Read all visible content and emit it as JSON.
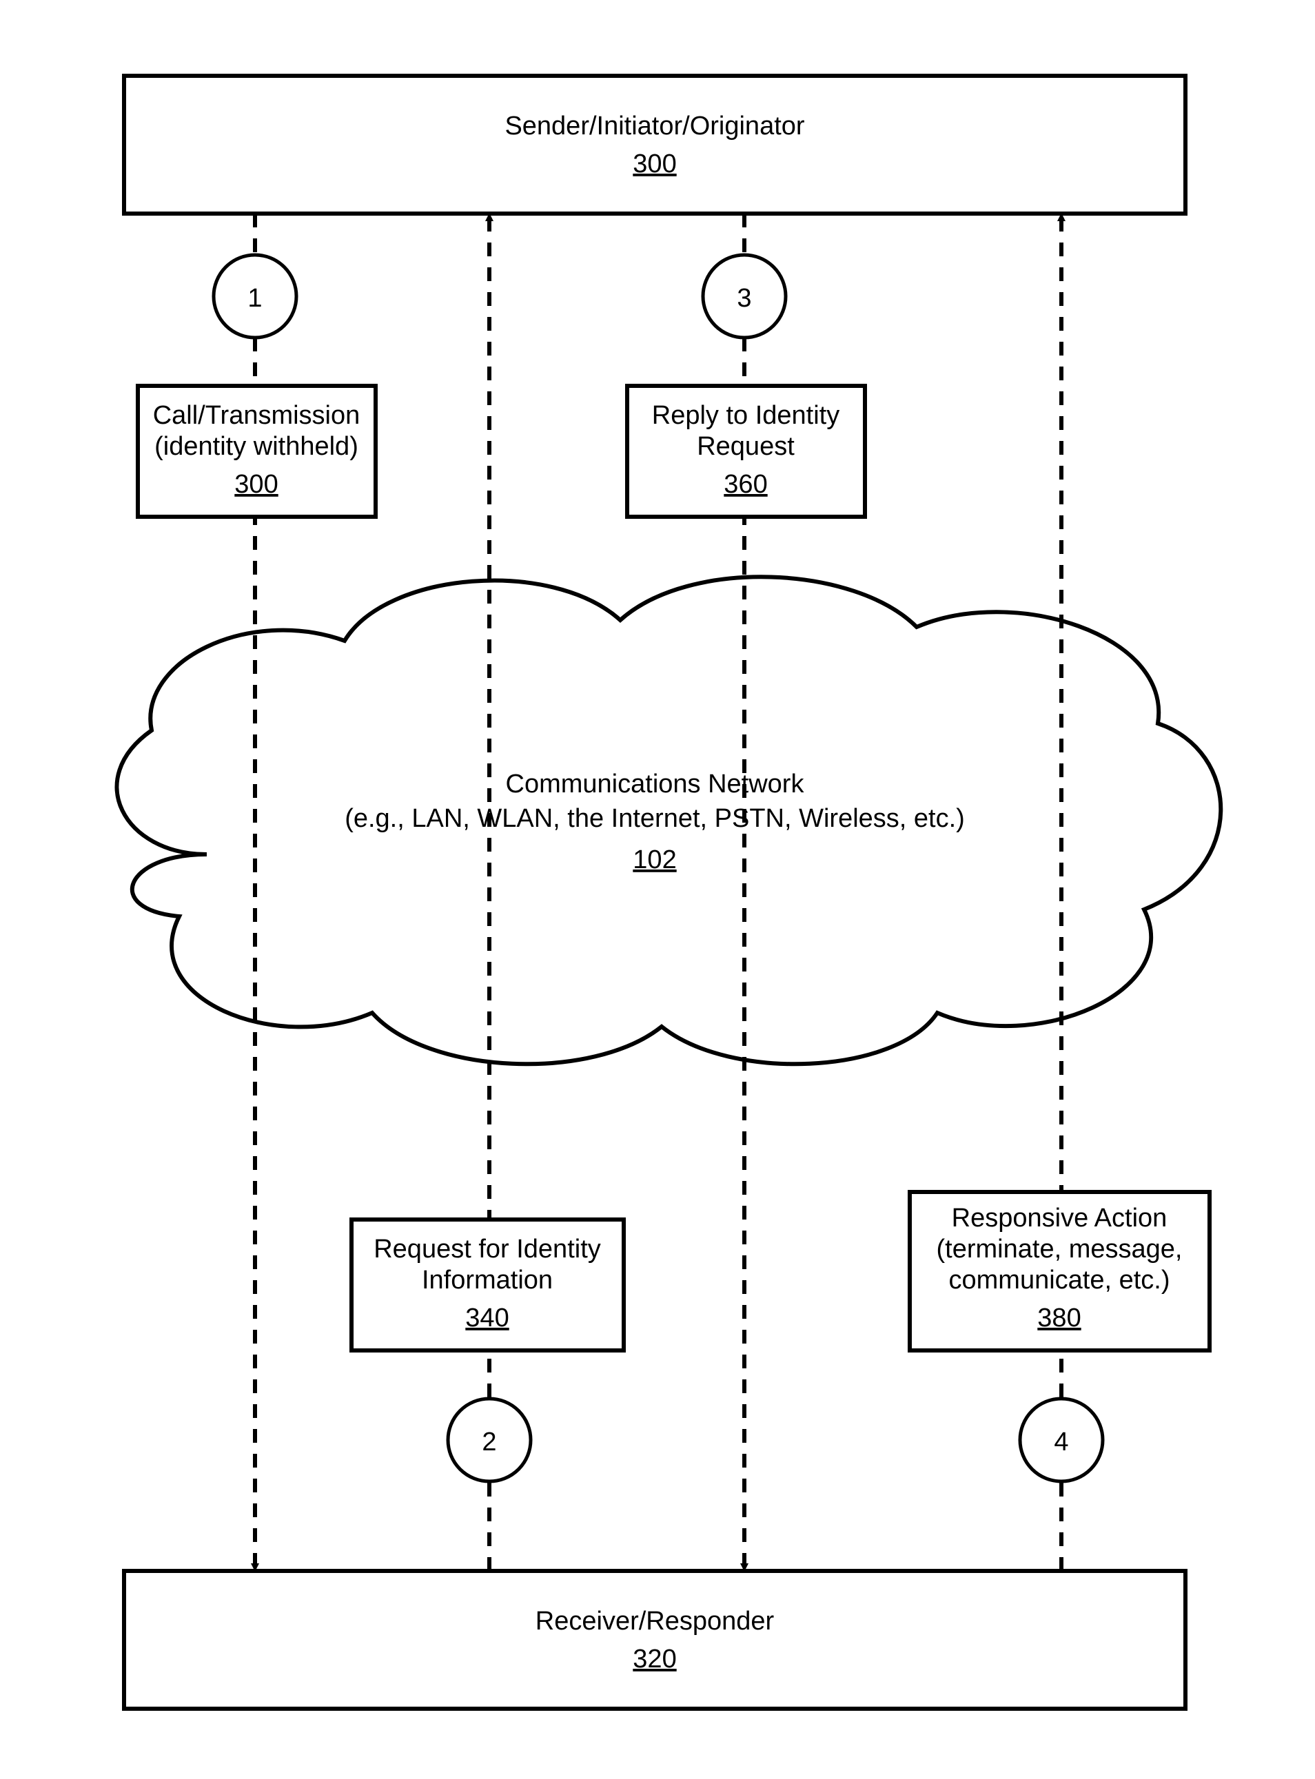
{
  "sender": {
    "label": "Sender/Initiator/Originator",
    "ref": "300"
  },
  "receiver": {
    "label": "Receiver/Responder",
    "ref": "320"
  },
  "network": {
    "line1": "Communications Network",
    "line2": "(e.g., LAN, WLAN, the Internet, PSTN, Wireless, etc.)",
    "ref": "102"
  },
  "msg1": {
    "line1": "Call/Transmission",
    "line2": "(identity withheld)",
    "ref": "300"
  },
  "msg2": {
    "line1": "Request for Identity",
    "line2": "Information",
    "ref": "340"
  },
  "msg3": {
    "line1": "Reply to Identity",
    "line2": "Request",
    "ref": "360"
  },
  "msg4": {
    "line1": "Responsive Action",
    "line2": "(terminate, message,",
    "line3": "communicate, etc.)",
    "ref": "380"
  },
  "steps": {
    "s1": "1",
    "s2": "2",
    "s3": "3",
    "s4": "4"
  }
}
